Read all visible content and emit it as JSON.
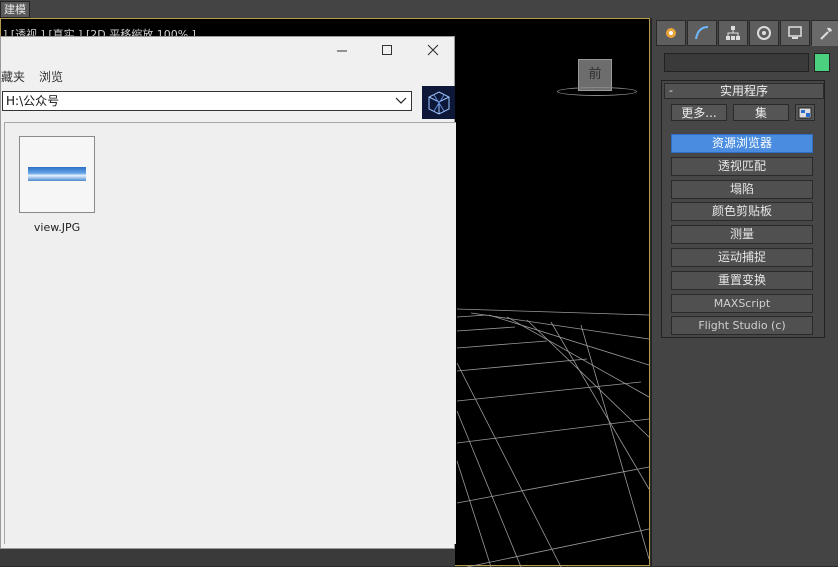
{
  "top_bar": {
    "mode_tab": "建模"
  },
  "viewport": {
    "label": "] [透视 ] [真实 ] [2D 平移缩放 100% ]",
    "viewcube_label": "前"
  },
  "command_panel": {
    "rollout_title": "实用程序",
    "rollout_toggle": "-",
    "more_button": "更多...",
    "sets_button": "集",
    "utilities": [
      {
        "label": "资源浏览器",
        "active": true
      },
      {
        "label": "透视匹配"
      },
      {
        "label": "塌陷"
      },
      {
        "label": "颜色剪贴板"
      },
      {
        "label": "测量"
      },
      {
        "label": "运动捕捉"
      },
      {
        "label": "重置变换"
      },
      {
        "label": "MAXScript"
      },
      {
        "label": "Flight Studio (c)"
      }
    ],
    "accent_color": "#4a8de0",
    "swatch_color": "#4ad07e"
  },
  "asset_browser": {
    "menu": [
      "藏夹",
      "浏览"
    ],
    "path": "H:\\公众号",
    "files": [
      {
        "name": "view.JPG"
      }
    ]
  }
}
